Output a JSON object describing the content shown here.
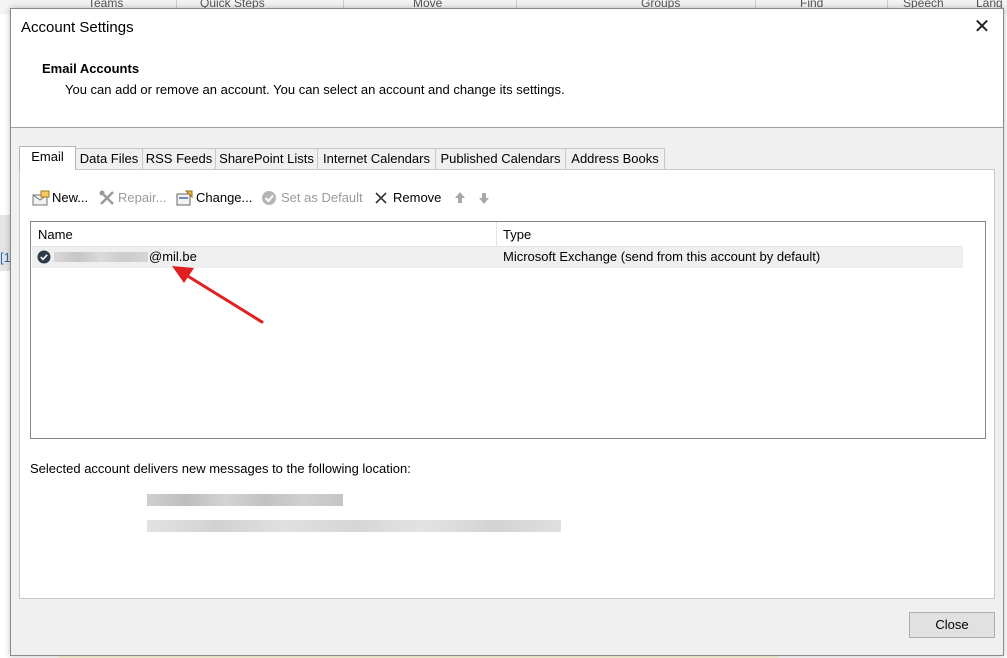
{
  "background": {
    "ribbon_labels": [
      "Teams",
      "Quick Steps",
      "Move",
      "Groups",
      "Find",
      "Speech",
      "Lang"
    ],
    "left_fragment": "[1"
  },
  "dialog": {
    "title": "Account Settings",
    "close_glyph": "✕",
    "header_title": "Email Accounts",
    "header_desc": "You can add or remove an account. You can select an account and change its settings.",
    "tabs": [
      "Email",
      "Data Files",
      "RSS Feeds",
      "SharePoint Lists",
      "Internet Calendars",
      "Published Calendars",
      "Address Books"
    ],
    "active_tab": "Email",
    "toolbar": {
      "new_label": "New...",
      "repair_label": "Repair...",
      "change_label": "Change...",
      "default_label": "Set as Default",
      "remove_label": "Remove",
      "icons": [
        "new-mailbox-icon",
        "tools-icon",
        "change-icon",
        "check-circle-icon",
        "remove-x-icon",
        "arrow-up-icon",
        "arrow-down-icon"
      ]
    },
    "list": {
      "columns": [
        "Name",
        "Type"
      ],
      "rows": [
        {
          "name_domain": "@mil.be",
          "type": "Microsoft Exchange (send from this account by default)"
        }
      ]
    },
    "deliver_text": "Selected account delivers new messages to the following location:",
    "close_button": "Close"
  },
  "colors": {
    "annotation_arrow": "#e02020",
    "dialog_bg": "#f0f0f0"
  }
}
